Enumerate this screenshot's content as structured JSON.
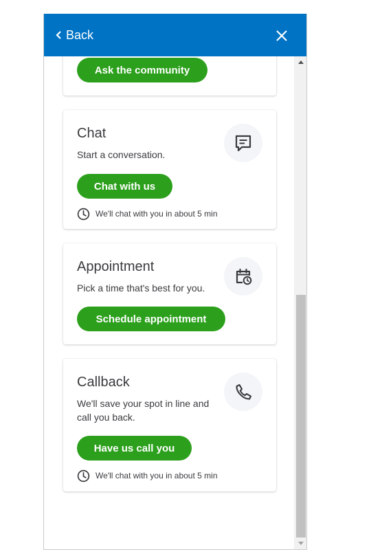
{
  "header": {
    "back_label": "Back",
    "close_icon": "close-icon",
    "back_icon": "chevron-left-icon",
    "background_color": "#0073c5"
  },
  "cards": {
    "community": {
      "button_label": "Ask the community"
    },
    "chat": {
      "title": "Chat",
      "description": "Start a conversation.",
      "button_label": "Chat with us",
      "wait_text": "We'll chat with you in about 5 min",
      "icon": "chat-bubble-icon"
    },
    "appointment": {
      "title": "Appointment",
      "description": "Pick a time that's best for you.",
      "button_label": "Schedule appointment",
      "icon": "calendar-clock-icon"
    },
    "callback": {
      "title": "Callback",
      "description": "We'll save your spot in line and call you back.",
      "button_label": "Have us call you",
      "wait_text": "We'll chat with you in about 5 min",
      "icon": "phone-icon"
    }
  },
  "colors": {
    "button_green": "#2ca01c",
    "text_dark": "#393a3d",
    "icon_bg": "#f4f5f8"
  }
}
